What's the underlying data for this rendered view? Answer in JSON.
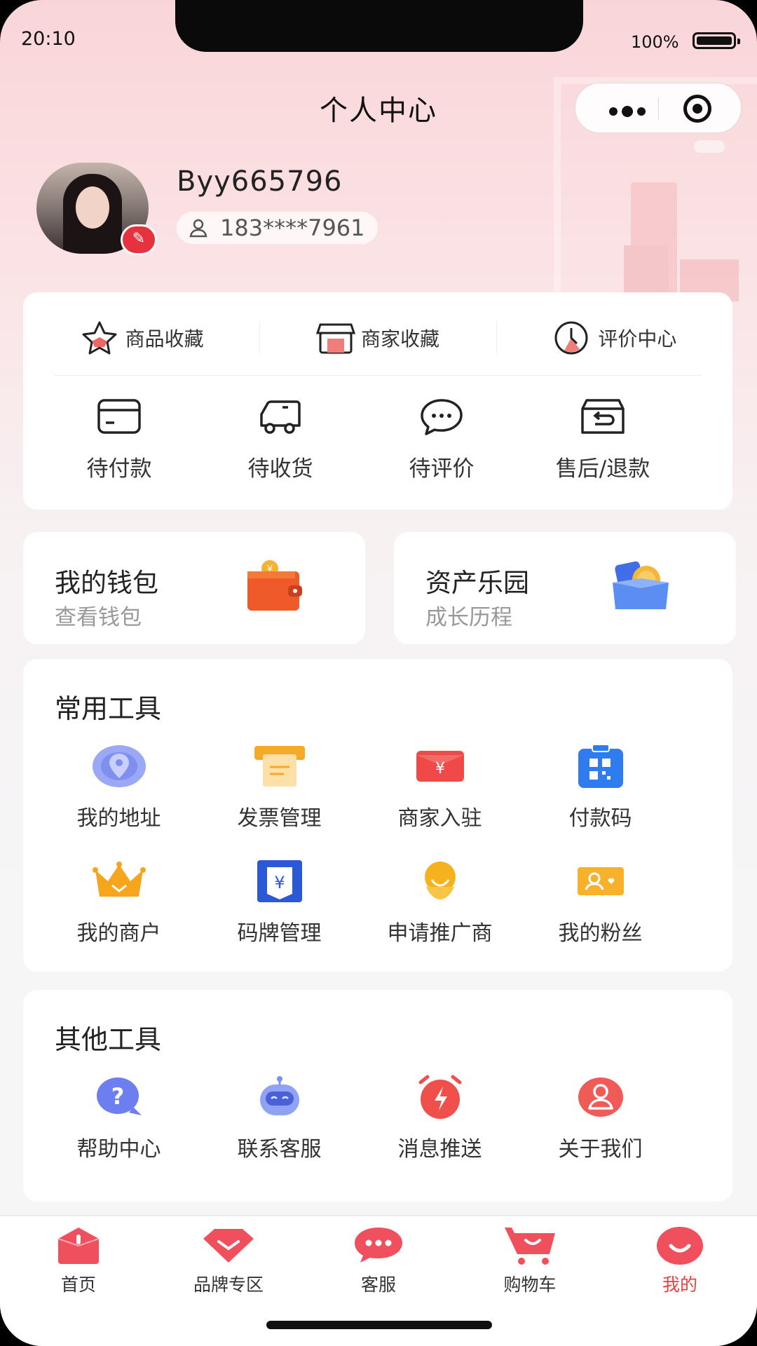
{
  "status_bar": {
    "time": "20:10",
    "battery": "100%"
  },
  "header": {
    "title": "个人中心",
    "menu_icon": "more-dots-icon",
    "close_icon": "target-circle-icon"
  },
  "profile": {
    "username": "Byy665796",
    "phone": "183****7961",
    "avatar": "user-avatar-photo",
    "edit_icon": "edit-pencil-icon"
  },
  "favorites": [
    {
      "label": "商品收藏",
      "icon": "star-icon"
    },
    {
      "label": "商家收藏",
      "icon": "store-icon"
    },
    {
      "label": "评价中心",
      "icon": "clock-icon"
    }
  ],
  "orders": [
    {
      "label": "待付款",
      "icon": "card-icon"
    },
    {
      "label": "待收货",
      "icon": "truck-icon"
    },
    {
      "label": "待评价",
      "icon": "chat-bubble-icon"
    },
    {
      "label": "售后/退款",
      "icon": "return-box-icon"
    }
  ],
  "wallet": {
    "title": "我的钱包",
    "subtitle": "查看钱包"
  },
  "asset": {
    "title": "资产乐园",
    "subtitle": "成长历程"
  },
  "common_tools": {
    "title": "常用工具",
    "items": [
      {
        "label": "我的地址",
        "icon": "location-pin-icon"
      },
      {
        "label": "发票管理",
        "icon": "invoice-icon"
      },
      {
        "label": "商家入驻",
        "icon": "yuan-envelope-icon"
      },
      {
        "label": "付款码",
        "icon": "qr-code-icon"
      },
      {
        "label": "我的商户",
        "icon": "crown-icon"
      },
      {
        "label": "码牌管理",
        "icon": "yuan-sign-icon"
      },
      {
        "label": "申请推广商",
        "icon": "promoter-icon"
      },
      {
        "label": "我的粉丝",
        "icon": "fans-card-icon"
      }
    ]
  },
  "other_tools": {
    "title": "其他工具",
    "items": [
      {
        "label": "帮助中心",
        "icon": "help-question-icon"
      },
      {
        "label": "联系客服",
        "icon": "robot-icon"
      },
      {
        "label": "消息推送",
        "icon": "alarm-clock-icon"
      },
      {
        "label": "关于我们",
        "icon": "person-circle-icon"
      }
    ]
  },
  "tabbar": [
    {
      "label": "首页",
      "icon": "home-icon",
      "active": false
    },
    {
      "label": "品牌专区",
      "icon": "diamond-icon",
      "active": false
    },
    {
      "label": "客服",
      "icon": "chat-icon",
      "active": false
    },
    {
      "label": "购物车",
      "icon": "cart-icon",
      "active": false
    },
    {
      "label": "我的",
      "icon": "smile-icon",
      "active": true
    }
  ],
  "colors": {
    "accent": "#e8413f",
    "bg_top": "#f9d5d8",
    "card": "#ffffff"
  }
}
